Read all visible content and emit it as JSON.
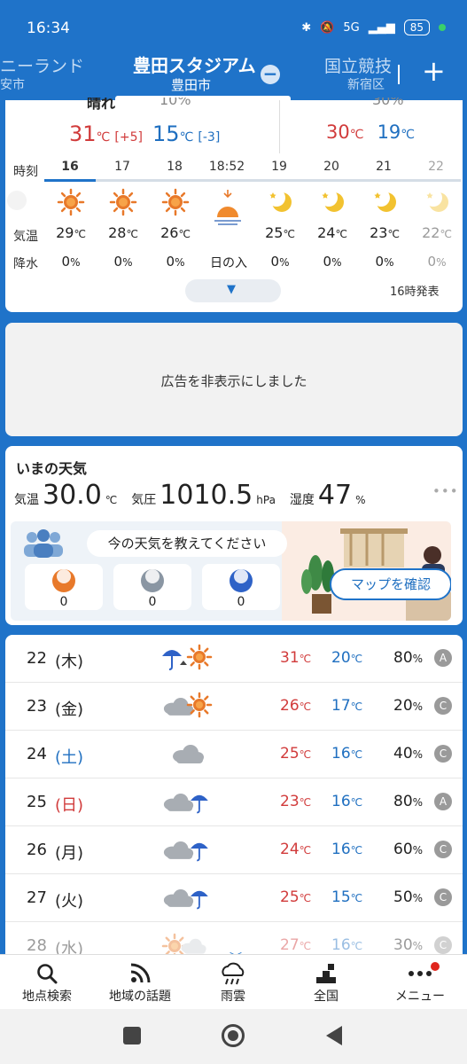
{
  "status_bar": {
    "time": "16:34",
    "network": "5G",
    "battery": "85"
  },
  "location_tabs": {
    "left": {
      "name": "ニーランド",
      "sub": "安市"
    },
    "current": {
      "name": "豊田スタジアム",
      "sub": "豊田市"
    },
    "right": {
      "name": "国立競技",
      "sub": "新宿区"
    },
    "remove_icon": "minus-circle-icon",
    "add_label": "+"
  },
  "today_summary": {
    "weather_partial": "晴れ",
    "pop_partial": "10%",
    "pop_right_partial": "30%",
    "hi": "31",
    "hi_diff": "[+5]",
    "lo": "15",
    "lo_diff": "[-3]",
    "hi2": "30",
    "lo2": "19",
    "unit": "℃"
  },
  "hourly": {
    "label_time": "時刻",
    "label_temp": "気温",
    "label_rain": "降水",
    "hours": [
      "16",
      "17",
      "18",
      "18:52",
      "19",
      "20",
      "21",
      "22"
    ],
    "icons": [
      "sun-icon",
      "sun-icon",
      "sun-icon",
      "sunset-icon",
      "moon-icon",
      "moon-icon",
      "moon-icon",
      "moon-icon"
    ],
    "temps": [
      "29",
      "28",
      "26",
      "",
      "25",
      "24",
      "23",
      "22"
    ],
    "rain": [
      "0",
      "0",
      "0",
      "日の入",
      "0",
      "0",
      "0",
      "0"
    ],
    "rain_unit": "%",
    "issued": "16時発表"
  },
  "ad": {
    "text": "広告を非表示にしました"
  },
  "now": {
    "title": "いまの天気",
    "temp_label": "気温",
    "temp": "30.0",
    "temp_unit": "℃",
    "pressure_label": "気圧",
    "pressure": "1010.5",
    "pressure_unit": "hPa",
    "humidity_label": "湿度",
    "humidity": "47",
    "humidity_unit": "%",
    "prompt": "今の天気を教えてください",
    "votes": [
      {
        "icon": "sun-icon",
        "count": "0",
        "color": "#e8792a"
      },
      {
        "icon": "cloud-icon",
        "count": "0",
        "color": "#8a96a3"
      },
      {
        "icon": "rain-umbrella-icon",
        "count": "0",
        "color": "#2e62c7"
      }
    ],
    "map_button": "マップを確認"
  },
  "weekly": [
    {
      "date": "22",
      "dow": "(木)",
      "dow_color": "#222",
      "icon": "umbrella-then-sun-icon",
      "hi": "31",
      "lo": "20",
      "pop": "80",
      "rank": "A"
    },
    {
      "date": "23",
      "dow": "(金)",
      "dow_color": "#222",
      "icon": "cloud-sun-icon",
      "hi": "26",
      "lo": "17",
      "pop": "20",
      "rank": "C"
    },
    {
      "date": "24",
      "dow": "(土)",
      "dow_color": "#1f6fc0",
      "icon": "cloud-icon",
      "hi": "25",
      "lo": "16",
      "pop": "40",
      "rank": "C"
    },
    {
      "date": "25",
      "dow": "(日)",
      "dow_color": "#d13b3b",
      "icon": "cloud-umbrella-icon",
      "hi": "23",
      "lo": "16",
      "pop": "80",
      "rank": "A"
    },
    {
      "date": "26",
      "dow": "(月)",
      "dow_color": "#222",
      "icon": "cloud-umbrella-icon",
      "hi": "24",
      "lo": "16",
      "pop": "60",
      "rank": "C"
    },
    {
      "date": "27",
      "dow": "(火)",
      "dow_color": "#222",
      "icon": "cloud-umbrella-icon",
      "hi": "25",
      "lo": "15",
      "pop": "50",
      "rank": "C"
    },
    {
      "date": "28",
      "dow": "(水)",
      "dow_color": "#222",
      "icon": "sun-cloud-icon",
      "hi": "27",
      "lo": "16",
      "pop": "30",
      "rank": "C"
    }
  ],
  "weekly_units": {
    "temp": "℃",
    "pop": "%"
  },
  "bottom_nav": [
    {
      "label": "地点検索",
      "icon": "search-icon"
    },
    {
      "label": "地域の話題",
      "icon": "feed-icon"
    },
    {
      "label": "雨雲",
      "icon": "rain-cloud-icon"
    },
    {
      "label": "全国",
      "icon": "map-pin-icon"
    },
    {
      "label": "メニュー",
      "icon": "more-icon"
    }
  ],
  "colors": {
    "brand": "#1f73c9",
    "hot": "#d13b3b",
    "cold": "#1f6fc0"
  }
}
